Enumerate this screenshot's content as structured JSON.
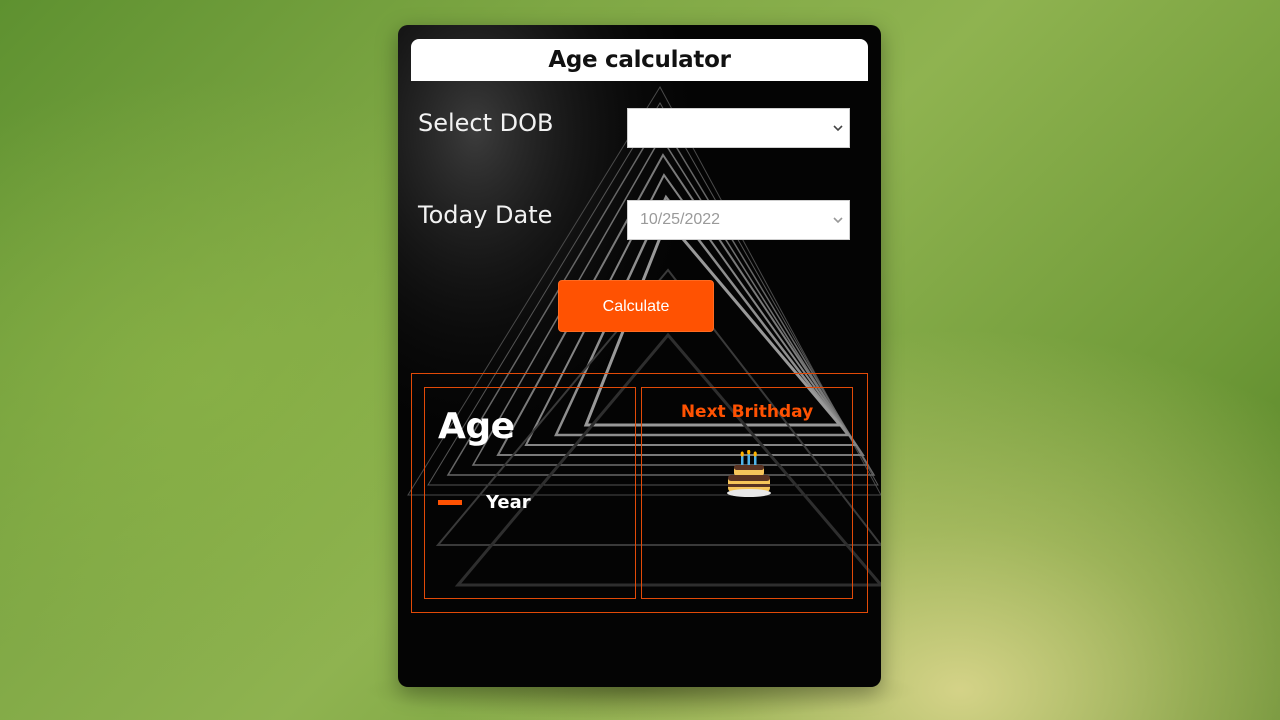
{
  "app": {
    "title": "Age calculator"
  },
  "form": {
    "dob_label": "Select DOB",
    "dob_value": "",
    "today_label": "Today Date",
    "today_value": "10/25/2022",
    "calculate_label": "Calculate"
  },
  "results": {
    "age_title": "Age",
    "age_value": "–",
    "year_label": "Year",
    "next_birthday_title": "Next Brithday"
  },
  "icons": {
    "dropdown": "chevron-down-icon",
    "cake": "birthday-cake-icon"
  },
  "colors": {
    "accent": "#ff5202",
    "panel_border": "#e24a08",
    "card_background": "#040404"
  }
}
